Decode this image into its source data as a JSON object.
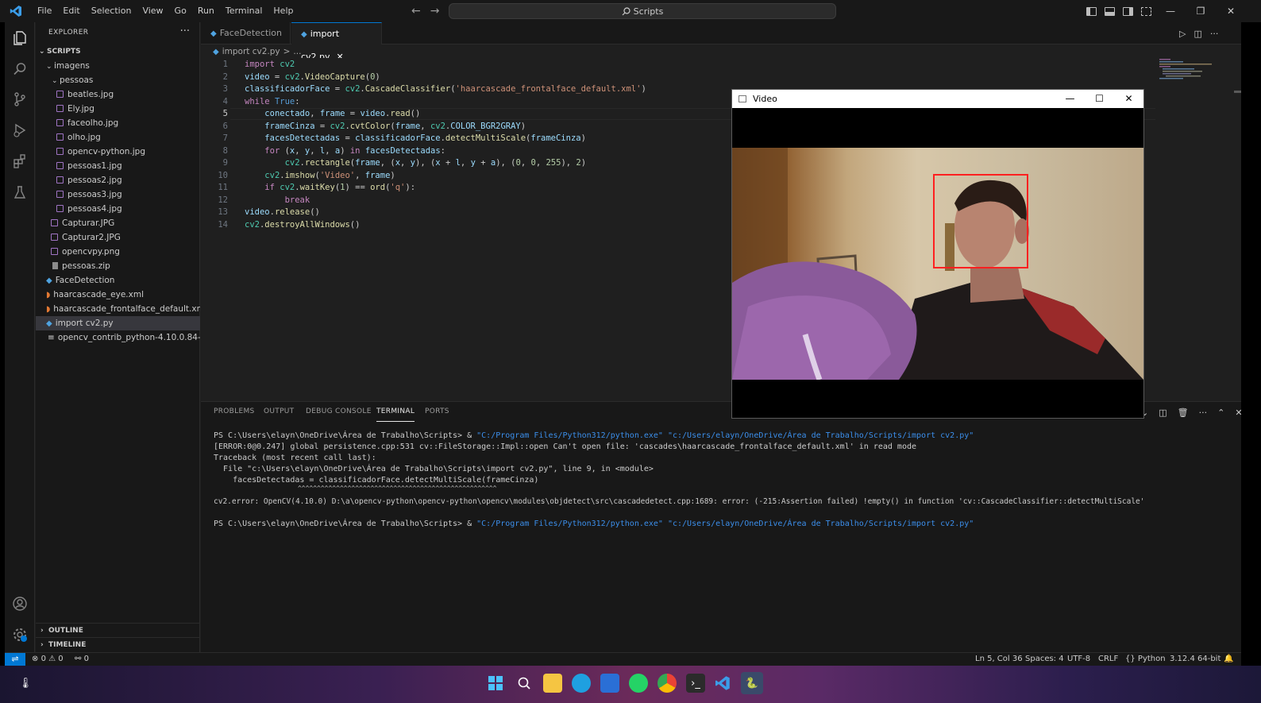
{
  "menu": [
    "File",
    "Edit",
    "Selection",
    "View",
    "Go",
    "Run",
    "Terminal",
    "Help"
  ],
  "search": {
    "label": "Scripts"
  },
  "explorer": {
    "title": "EXPLORER",
    "root": "SCRIPTS",
    "items": [
      {
        "label": "imagens",
        "kind": "folder"
      },
      {
        "label": "pessoas",
        "kind": "folder"
      },
      {
        "label": "beatles.jpg",
        "kind": "image"
      },
      {
        "label": "Ely.jpg",
        "kind": "image"
      },
      {
        "label": "faceolho.jpg",
        "kind": "image"
      },
      {
        "label": "olho.jpg",
        "kind": "image"
      },
      {
        "label": "opencv-python.jpg",
        "kind": "image"
      },
      {
        "label": "pessoas1.jpg",
        "kind": "image"
      },
      {
        "label": "pessoas2.jpg",
        "kind": "image"
      },
      {
        "label": "pessoas3.jpg",
        "kind": "image"
      },
      {
        "label": "pessoas4.jpg",
        "kind": "image"
      },
      {
        "label": "Capturar.JPG",
        "kind": "image"
      },
      {
        "label": "Capturar2.JPG",
        "kind": "image"
      },
      {
        "label": "opencvpy.png",
        "kind": "image"
      },
      {
        "label": "pessoas.zip",
        "kind": "zip"
      },
      {
        "label": "FaceDetection",
        "kind": "python"
      },
      {
        "label": "haarcascade_eye.xml",
        "kind": "xml"
      },
      {
        "label": "haarcascade_frontalface_default.xml",
        "kind": "xml"
      },
      {
        "label": "import cv2.py",
        "kind": "python",
        "selected": true
      },
      {
        "label": "opencv_contrib_python-4.10.0.84-cp...",
        "kind": "file"
      }
    ],
    "outline": "OUTLINE",
    "timeline": "TIMELINE"
  },
  "tabs": [
    {
      "label": "FaceDetection"
    },
    {
      "label": "import cv2.py",
      "active": true,
      "close": "✕"
    }
  ],
  "breadcrumb": {
    "file": "import cv2.py",
    "sep": ">",
    "rest": "..."
  },
  "code_lines": [
    "1",
    "2",
    "3",
    "4",
    "5",
    "6",
    "7",
    "8",
    "9",
    "10",
    "11",
    "12",
    "13",
    "14"
  ],
  "video_window": {
    "title": "Video",
    "minimize": "—",
    "maximize": "☐",
    "close": "✕"
  },
  "panel": {
    "tabs": [
      "PROBLEMS",
      "OUTPUT",
      "DEBUG CONSOLE",
      "TERMINAL",
      "PORTS"
    ],
    "active_tab": "TERMINAL",
    "terminal": {
      "prompt1": "PS C:\\Users\\elayn\\OneDrive\\Área de Trabalho\\Scripts> & ",
      "cmd1": "\"C:/Program Files/Python312/python.exe\" \"c:/Users/elayn/OneDrive/Área de Trabalho/Scripts/import cv2.py\"",
      "line2": "[ERROR:0@0.247] global persistence.cpp:531 cv::FileStorage::Impl::open Can't open file: 'cascades\\haarcascade_frontalface_default.xml' in read mode",
      "line3": "Traceback (most recent call last):",
      "line4": "  File \"c:\\Users\\elayn\\OneDrive\\Área de Trabalho\\Scripts\\import cv2.py\", line 9, in <module>",
      "line5": "    facesDetectadas = classificadorFace.detectMultiScale(frameCinza)",
      "line6": "                      ^^^^^^^^^^^^^^^^^^^^^^^^^^^^^^^^^^^^^^^^^^^^^^^^^^^^",
      "line7": "cv2.error: OpenCV(4.10.0) D:\\a\\opencv-python\\opencv-python\\opencv\\modules\\objdetect\\src\\cascadedetect.cpp:1689: error: (-215:Assertion failed) !empty() in function 'cv::CascadeClassifier::detectMultiScale'",
      "prompt2": "PS C:\\Users\\elayn\\OneDrive\\Área de Trabalho\\Scripts> & ",
      "cmd2": "\"C:/Program Files/Python312/python.exe\" \"c:/Users/elayn/OneDrive/Área de Trabalho/Scripts/import cv2.py\""
    }
  },
  "statusbar": {
    "errors": "0",
    "warnings": "0",
    "ports": "0",
    "position": "Ln 5, Col 36",
    "spaces": "Spaces: 4",
    "encoding": "UTF-8",
    "eol": "CRLF",
    "language": "Python",
    "interpreter": "3.12.4 64-bit"
  },
  "colors": {
    "accent": "#0078d4",
    "face_box": "#ff2020",
    "keyword": "#c586c0",
    "string": "#ce9178",
    "function": "#dcdcaa",
    "variable": "#9cdcfe"
  }
}
